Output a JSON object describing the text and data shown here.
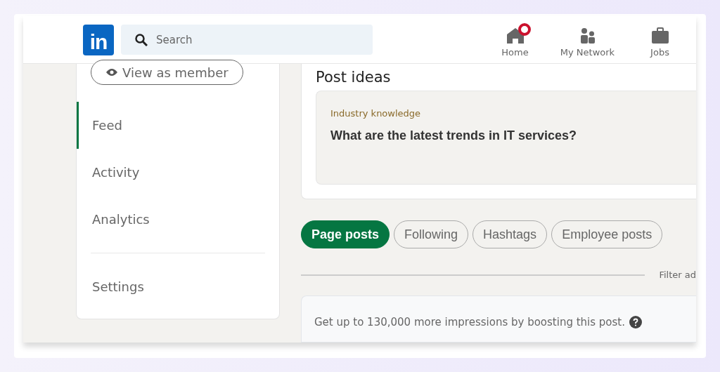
{
  "header": {
    "logo": "in",
    "search": {
      "placeholder": "Search"
    },
    "nav": [
      {
        "label": "Home",
        "kind": "home",
        "notification": true
      },
      {
        "label": "My Network",
        "kind": "network",
        "notification": false
      },
      {
        "label": "Jobs",
        "kind": "jobs",
        "notification": false
      }
    ]
  },
  "sidebar": {
    "view_button": "View as member",
    "items": [
      {
        "label": "Feed",
        "selected": true
      },
      {
        "label": "Activity",
        "selected": false
      },
      {
        "label": "Analytics",
        "selected": false
      },
      {
        "label": "Settings",
        "selected": false
      }
    ]
  },
  "post_ideas": {
    "title": "Post ideas",
    "category": "Industry knowledge",
    "question": "What are the latest trends in IT services?"
  },
  "filters": [
    {
      "label": "Page posts",
      "selected": true
    },
    {
      "label": "Following",
      "selected": false
    },
    {
      "label": "Hashtags",
      "selected": false
    },
    {
      "label": "Employee posts",
      "selected": false
    }
  ],
  "filter_label": "Filter ad",
  "boost": {
    "text": "Get up to 130,000 more impressions by boosting this post."
  }
}
